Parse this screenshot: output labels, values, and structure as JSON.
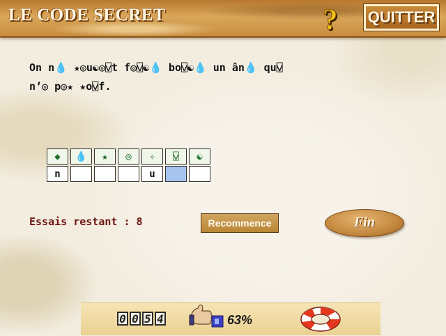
{
  "header": {
    "title": "LE CODE SECRET",
    "help_icon": "question-mark-icon",
    "quit_label": "QUITTER"
  },
  "puzzle": {
    "encoded_line1": "On n💧 ★◎u☯◎⍌t f◎⍌☯💧 bo⍌☯💧 un ân💧 qu⍌",
    "encoded_line2": "n’◎ p◎★ ★o⍌f."
  },
  "cipher": {
    "symbols": [
      "◆",
      "💧",
      "★",
      "◎",
      "✧",
      "⍌",
      "☯"
    ],
    "symbol_color": "#1f6e2c",
    "answers": [
      "n",
      "",
      "",
      "",
      "u",
      "",
      ""
    ],
    "selected_index": 5,
    "selected_color": "#a7c4ee"
  },
  "status": {
    "tries_text": "Essais restant : 8",
    "restart_label": "Recommence",
    "end_label": "Fin"
  },
  "bottom": {
    "score_digits": [
      "0",
      "0",
      "5",
      "4"
    ],
    "percent": "63%",
    "thumb_icon": "thumbs-up-icon",
    "lifebuoy_icon": "lifebuoy-icon"
  },
  "colors": {
    "banner": "#c98c3f",
    "tries_text": "#6e1410",
    "quit_border": "#fff1d0"
  }
}
